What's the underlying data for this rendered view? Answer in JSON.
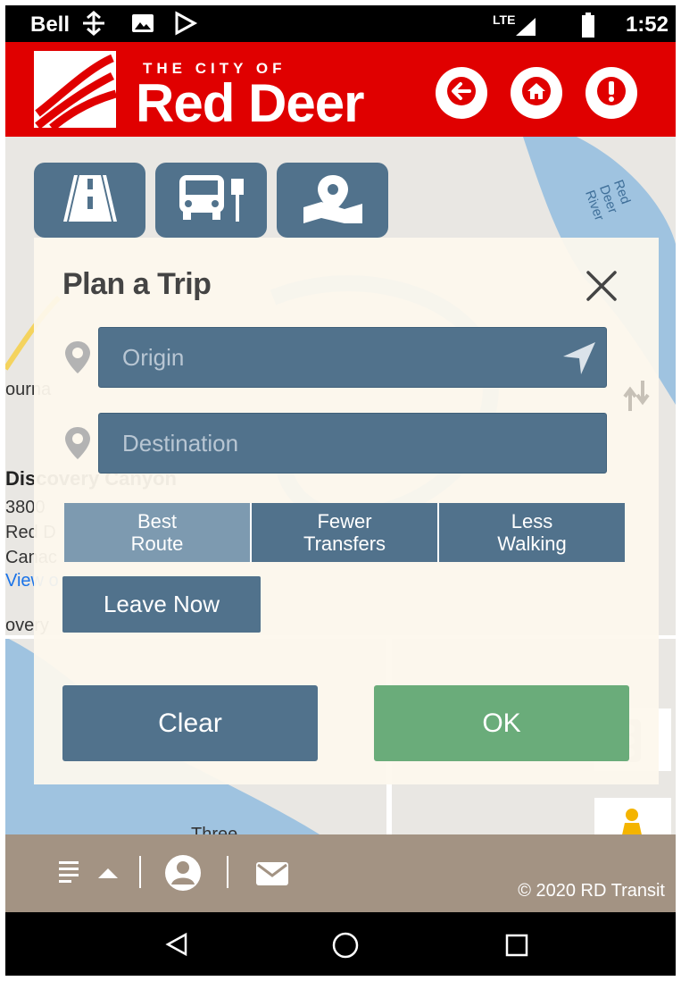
{
  "status_bar": {
    "carrier": "Bell",
    "network": "LTE",
    "time": "1:52"
  },
  "header": {
    "logo_small": "THE CITY OF",
    "logo_big": "Red Deer",
    "brand_color": "#e00000"
  },
  "map": {
    "labels": {
      "river": "Red Deer River",
      "partial_left": "ourna",
      "poi_title": "Discovery Canyon",
      "poi_addr1": "3800",
      "poi_addr2": "Red D",
      "poi_addr3": "Canac",
      "poi_link": "View o",
      "partial_river": "Red Deer Ri",
      "partial_overy": "overy",
      "three": "Three"
    }
  },
  "mode_tabs": [
    "road-icon",
    "bus-stop-icon",
    "map-pin-icon"
  ],
  "panel": {
    "title": "Plan a Trip",
    "origin_placeholder": "Origin",
    "destination_placeholder": "Destination",
    "preferences": [
      {
        "line1": "Best",
        "line2": "Route",
        "active": true
      },
      {
        "line1": "Fewer",
        "line2": "Transfers",
        "active": false
      },
      {
        "line1": "Less",
        "line2": "Walking",
        "active": false
      }
    ],
    "leave_now": "Leave Now",
    "clear": "Clear",
    "ok": "OK",
    "colors": {
      "field": "#51728c",
      "ok": "#6aac7a"
    }
  },
  "footer": {
    "copyright": "© 2020 RD Transit"
  }
}
